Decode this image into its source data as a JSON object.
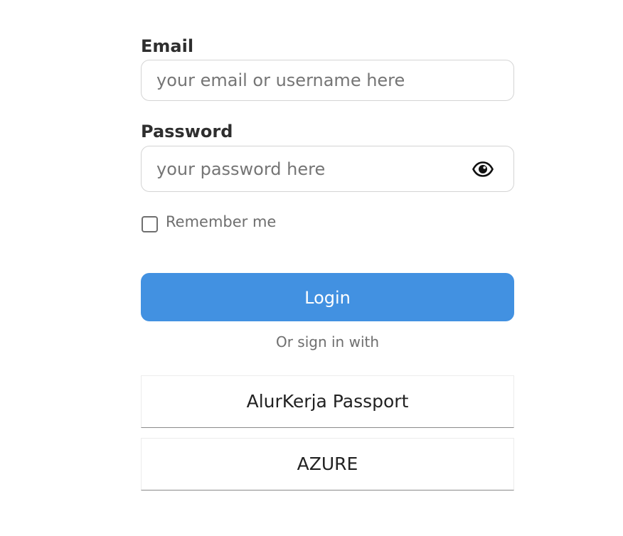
{
  "login_form": {
    "email": {
      "label": "Email",
      "value": "",
      "placeholder": "your email or username here"
    },
    "password": {
      "label": "Password",
      "value": "",
      "placeholder": "your password here",
      "toggle_icon": "eye-icon"
    },
    "remember_me": {
      "label": "Remember me",
      "checked": false
    },
    "login_button_label": "Login",
    "alt_signin_text": "Or sign in with",
    "sso_providers": [
      {
        "label": "AlurKerja Passport"
      },
      {
        "label": "AZURE"
      }
    ]
  },
  "colors": {
    "primary": "#4291e1",
    "label_text": "#2e2e2e",
    "muted_text": "#6e6e6e",
    "input_border": "#d4d4d4"
  }
}
